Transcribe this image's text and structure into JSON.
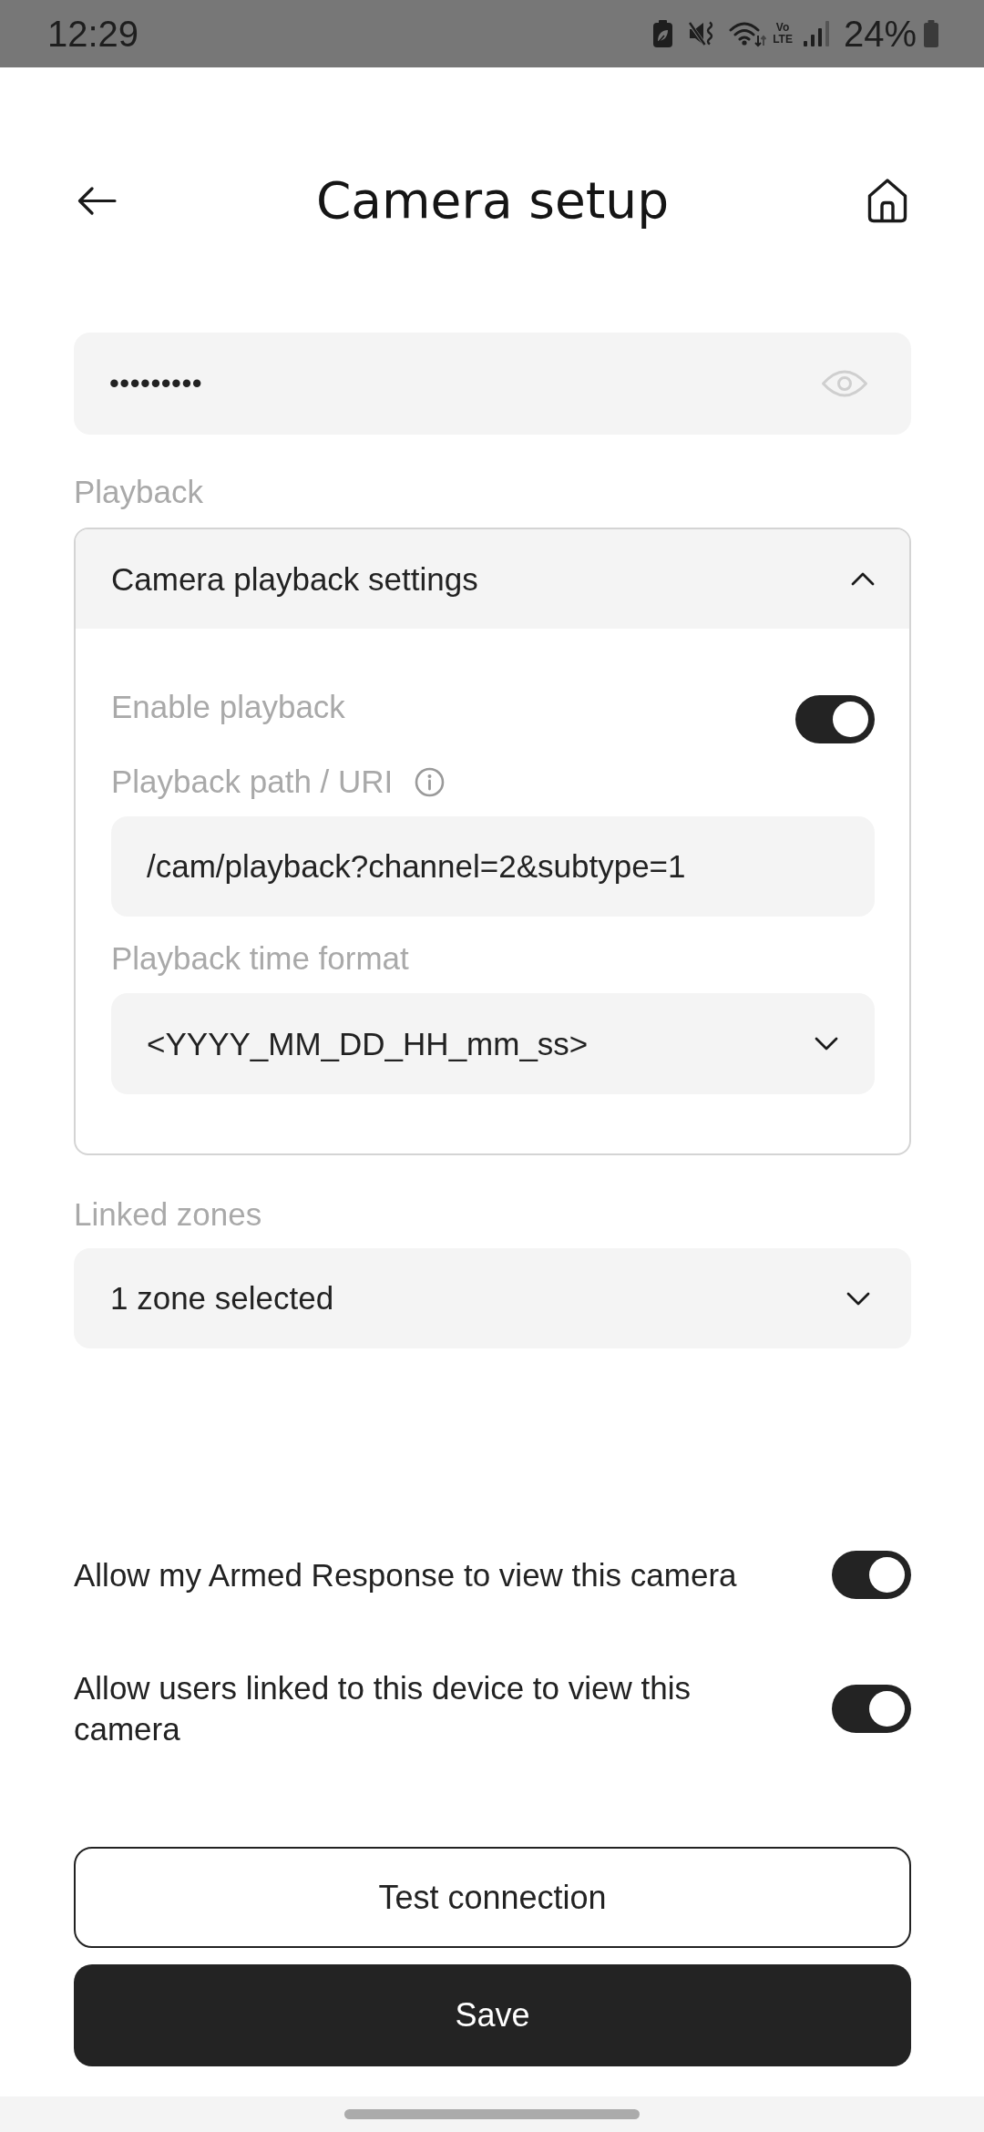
{
  "status_bar": {
    "time": "12:29",
    "network_badge": [
      "Vo",
      "LTE"
    ],
    "battery": "24%"
  },
  "header": {
    "title": "Camera setup"
  },
  "password_field": {
    "value": "•••••••••"
  },
  "playback": {
    "label": "Playback",
    "panel": {
      "title": "Camera playback settings",
      "expanded": true,
      "enable": {
        "label": "Enable playback",
        "on": true
      },
      "path": {
        "label": "Playback path / URI",
        "value": "/cam/playback?channel=2&subtype=1"
      },
      "time_format": {
        "label": "Playback time format",
        "value": "<YYYY_MM_DD_HH_mm_ss>"
      }
    }
  },
  "linked_zones": {
    "label": "Linked zones",
    "value": "1 zone selected"
  },
  "permissions": [
    {
      "label": "Allow my Armed Response to view this camera",
      "on": true
    },
    {
      "label": "Allow users linked to this device to view this camera",
      "on": true
    }
  ],
  "buttons": [
    {
      "label": "Test connection",
      "kind": "outline"
    },
    {
      "label": "Save",
      "kind": "filled"
    }
  ]
}
